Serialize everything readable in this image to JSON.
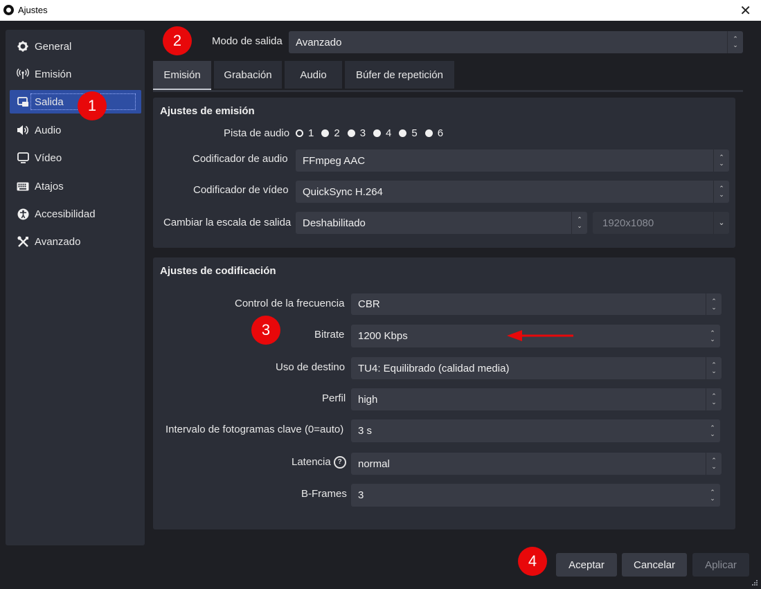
{
  "window": {
    "title": "Ajustes",
    "close_glyph": "✕"
  },
  "sidebar": {
    "items": [
      {
        "label": "General",
        "icon": "gear-icon"
      },
      {
        "label": "Emisión",
        "icon": "broadcast-icon"
      },
      {
        "label": "Salida",
        "icon": "output-icon",
        "selected": true
      },
      {
        "label": "Audio",
        "icon": "speaker-icon"
      },
      {
        "label": "Vídeo",
        "icon": "monitor-icon"
      },
      {
        "label": "Atajos",
        "icon": "keyboard-icon"
      },
      {
        "label": "Accesibilidad",
        "icon": "accessibility-icon"
      },
      {
        "label": "Avanzado",
        "icon": "tools-icon"
      }
    ]
  },
  "output_mode": {
    "label": "Modo de salida",
    "value": "Avanzado"
  },
  "tabs": [
    {
      "label": "Emisión",
      "active": true
    },
    {
      "label": "Grabación"
    },
    {
      "label": "Audio"
    },
    {
      "label": "Búfer de repetición"
    }
  ],
  "stream_settings": {
    "title": "Ajustes de emisión",
    "audio_track": {
      "label": "Pista de audio",
      "options": [
        "1",
        "2",
        "3",
        "4",
        "5",
        "6"
      ],
      "selected": "1"
    },
    "audio_encoder": {
      "label": "Codificador de audio",
      "value": "FFmpeg AAC"
    },
    "video_encoder": {
      "label": "Codificador de vídeo",
      "value": "QuickSync H.264"
    },
    "rescale": {
      "label": "Cambiar la escala de salida",
      "value": "Deshabilitado",
      "resolution": "1920x1080"
    }
  },
  "encoder_settings": {
    "title": "Ajustes de codificación",
    "rate_control": {
      "label": "Control de la frecuencia",
      "value": "CBR"
    },
    "bitrate": {
      "label": "Bitrate",
      "value": "1200 Kbps"
    },
    "target_usage": {
      "label": "Uso de destino",
      "value": "TU4: Equilibrado (calidad media)"
    },
    "profile": {
      "label": "Perfil",
      "value": "high"
    },
    "keyframe_interval": {
      "label": "Intervalo de fotogramas clave (0=auto)",
      "value": "3 s"
    },
    "latency": {
      "label": "Latencia",
      "value": "normal",
      "help_glyph": "?"
    },
    "bframes": {
      "label": "B-Frames",
      "value": "3"
    }
  },
  "buttons": {
    "accept": "Aceptar",
    "cancel": "Cancelar",
    "apply": "Aplicar"
  },
  "markers": {
    "m1": "1",
    "m2": "2",
    "m3": "3",
    "m4": "4"
  },
  "colors": {
    "selected": "#2e4ea3",
    "marker": "#e8080a",
    "arrow": "#e8080a",
    "panel": "#2b2e37",
    "field": "#383b45"
  }
}
